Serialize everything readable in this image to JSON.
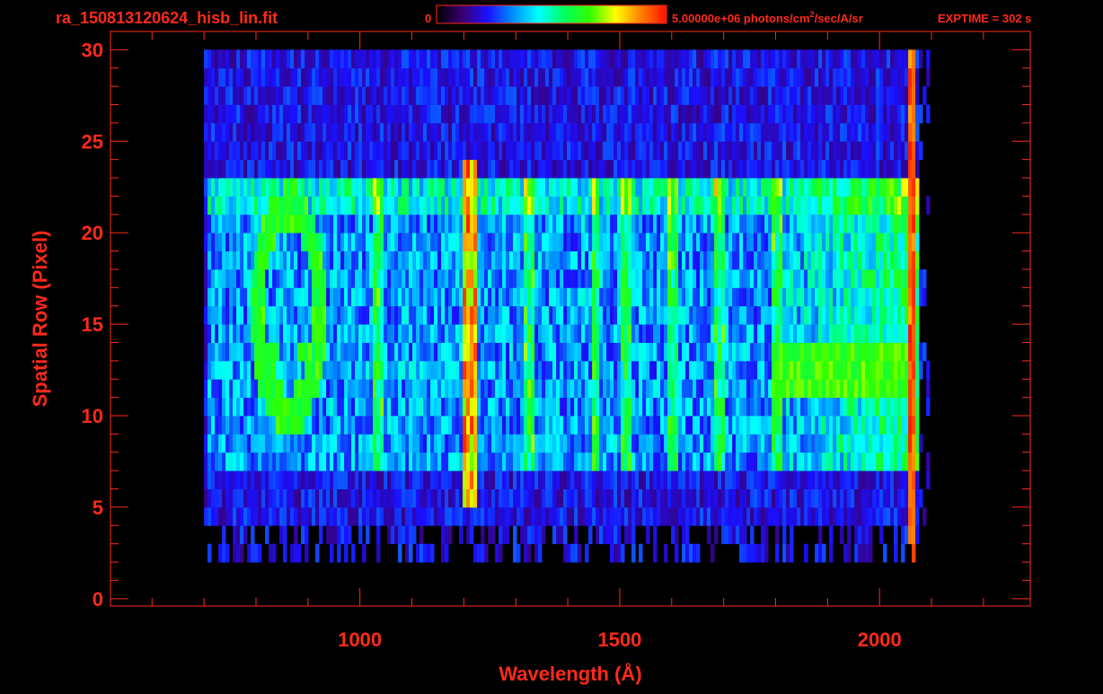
{
  "header": {
    "filename": "ra_150813120624_hisb_lin.fit",
    "colorbar_min": "0",
    "colorbar_max": "5.00000e+06",
    "units_pre": " photons/cm",
    "units_sup": "2",
    "units_post": "/sec/A/sr",
    "exptime": "EXPTIME = 302 s"
  },
  "colors": {
    "background": "#000000",
    "axis": "#ff2a1a",
    "text": "#ff2a1a"
  },
  "colorbar": {
    "stops": [
      "#000000",
      "#3a0070",
      "#1a10ff",
      "#0090ff",
      "#00ffff",
      "#00ff60",
      "#30ff00",
      "#ffff00",
      "#ff8000",
      "#ff1000"
    ]
  },
  "chart_data": {
    "type": "heatmap",
    "title": "",
    "xlabel": "Wavelength (Å)",
    "ylabel": "Spatial Row (Pixel)",
    "xlim": [
      520,
      2290
    ],
    "ylim": [
      -0.4,
      31
    ],
    "x_ticks": [
      1000,
      1500,
      2000
    ],
    "y_ticks": [
      0,
      5,
      10,
      15,
      20,
      25,
      30
    ],
    "x_minor_step": 100,
    "y_minor_step": 1,
    "data_extent": {
      "x": [
        700,
        2095
      ],
      "y": [
        1.5,
        30
      ]
    },
    "color_scale": {
      "min": 0,
      "max": 5000000,
      "scale": "linear"
    },
    "features": [
      {
        "kind": "vertical-line",
        "x_center": 1210,
        "width": 30,
        "y": [
          5,
          23.5
        ],
        "level": 0.95
      },
      {
        "kind": "ring",
        "center": [
          860,
          15.8
        ],
        "radius_x": 60,
        "radius_y": 5.6,
        "width_x": 26,
        "width_y": 1.5,
        "level": 0.55
      },
      {
        "kind": "lower-ring",
        "center": [
          860,
          12.2
        ],
        "radius_x": 40,
        "radius_y": 2.2,
        "level": 0.55
      },
      {
        "kind": "continuum-band",
        "x": [
          700,
          2070
        ],
        "y": [
          7,
          23
        ],
        "level": 0.38
      },
      {
        "kind": "bright-band",
        "x": [
          1790,
          2060
        ],
        "y": [
          11,
          14
        ],
        "level": 0.6
      },
      {
        "kind": "edge-spike",
        "x": 2060,
        "y": [
          2,
          30
        ],
        "level": 0.85
      }
    ]
  }
}
